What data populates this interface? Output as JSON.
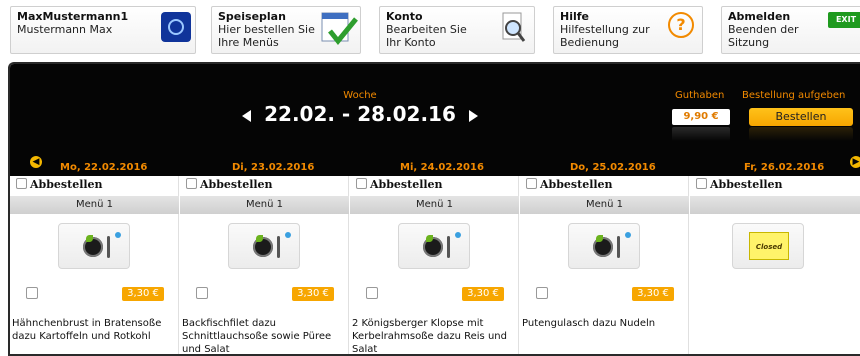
{
  "topbar": {
    "user": {
      "line1": "MaxMustermann1",
      "line2": "Mustermann Max"
    },
    "speiseplan": {
      "title": "Speiseplan",
      "line1": "Hier bestellen Sie",
      "line2": "Ihre Menüs"
    },
    "konto": {
      "title": "Konto",
      "line1": "Bearbeiten Sie",
      "line2": "Ihr Konto"
    },
    "hilfe": {
      "title": "Hilfe",
      "line1": "Hilfestellung zur",
      "line2": "Bedienung"
    },
    "abmelden": {
      "title": "Abmelden",
      "line1": "Beenden der",
      "line2": "Sitzung",
      "exit_label": "EXIT"
    }
  },
  "header": {
    "week_label": "Woche",
    "week_range": "22.02. - 28.02.16",
    "guthaben_label": "Guthaben",
    "guthaben_value": "9,90 €",
    "order_label": "Bestellung aufgeben",
    "order_button": "Bestellen"
  },
  "days": [
    {
      "label": "Mo, 22.02.2016",
      "cancel": "Abbestellen",
      "menu": "Menü 1",
      "price": "3,30 €",
      "desc": "Hähnchenbrust in Bratensoße dazu Kartoffeln und Rotkohl"
    },
    {
      "label": "Di, 23.02.2016",
      "cancel": "Abbestellen",
      "menu": "Menü 1",
      "price": "3,30 €",
      "desc": "Backfischfilet dazu Schnittlauchsoße sowie Püree und Salat"
    },
    {
      "label": "Mi, 24.02.2016",
      "cancel": "Abbestellen",
      "menu": "Menü 1",
      "price": "3,30 €",
      "desc": "2 Königsberger Klopse mit Kerbelrahmsoße dazu Reis und Salat"
    },
    {
      "label": "Do, 25.02.2016",
      "cancel": "Abbestellen",
      "menu": "Menü 1",
      "price": "3,30 €",
      "desc": "Putengulasch dazu Nudeln"
    },
    {
      "label": "Fr, 26.02.2016",
      "cancel": "Abbestellen",
      "closed_label": "Closed"
    }
  ],
  "colors": {
    "accent": "#f28a00",
    "button": "#f7a600",
    "header_bg": "#050505"
  },
  "icons": [
    "user-avatar-icon",
    "calendar-check-icon",
    "document-search-icon",
    "help-question-icon",
    "exit-icon",
    "prev-week-arrow",
    "next-week-arrow"
  ]
}
